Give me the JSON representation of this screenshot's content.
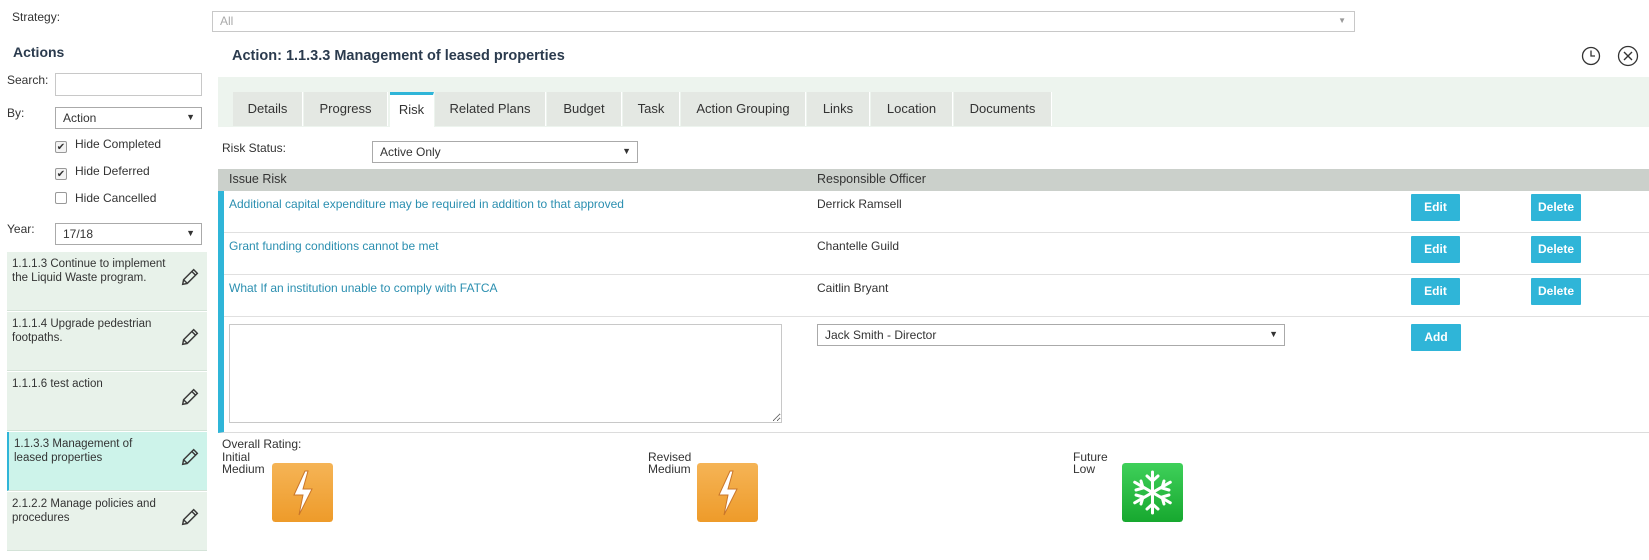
{
  "strategy": {
    "label": "Strategy:",
    "value": "All"
  },
  "sidebar": {
    "title": "Actions",
    "search_label": "Search:",
    "search_value": "",
    "by_label": "By:",
    "by_value": "Action",
    "checkboxes": [
      {
        "label": "Hide Completed",
        "checked": true
      },
      {
        "label": "Hide Deferred",
        "checked": true
      },
      {
        "label": "Hide Cancelled",
        "checked": false
      }
    ],
    "year_label": "Year:",
    "year_value": "17/18",
    "items": [
      {
        "text": "1.1.1.3 Continue to implement the Liquid Waste program."
      },
      {
        "text": "1.1.1.4 Upgrade pedestrian footpaths."
      },
      {
        "text": "1.1.1.6 test action"
      },
      {
        "text": "1.1.3.3 Management of leased properties",
        "active": true
      },
      {
        "text": "2.1.2.2 Manage policies and procedures"
      }
    ]
  },
  "main": {
    "title": "Action: 1.1.3.3 Management of leased properties",
    "tabs": [
      "Details",
      "Progress",
      "Risk",
      "Related Plans",
      "Budget",
      "Task",
      "Action Grouping",
      "Links",
      "Location",
      "Documents"
    ],
    "active_tab": "Risk",
    "risk_status_label": "Risk Status:",
    "risk_status_value": "Active Only",
    "table": {
      "headers": [
        "Issue Risk",
        "Responsible Officer"
      ],
      "rows": [
        {
          "risk": "Additional capital expenditure may be required in addition to that approved",
          "officer": "Derrick Ramsell"
        },
        {
          "risk": "Grant funding conditions cannot be met",
          "officer": "Chantelle Guild"
        },
        {
          "risk": "What If an institution unable to comply with FATCA",
          "officer": "Caitlin Bryant"
        }
      ],
      "edit_label": "Edit",
      "delete_label": "Delete",
      "add_label": "Add",
      "new_officer_value": "Jack Smith - Director"
    },
    "overall_rating_label": "Overall Rating:",
    "ratings": [
      {
        "stage": "Initial",
        "level": "Medium",
        "icon": "lightning-icon"
      },
      {
        "stage": "Revised",
        "level": "Medium",
        "icon": "lightning-icon"
      },
      {
        "stage": "Future",
        "level": "Low",
        "icon": "snowflake-icon"
      }
    ]
  },
  "colors": {
    "accent": "#2fb5d8",
    "medium": "#f0a53c",
    "low": "#1fbf3c"
  }
}
